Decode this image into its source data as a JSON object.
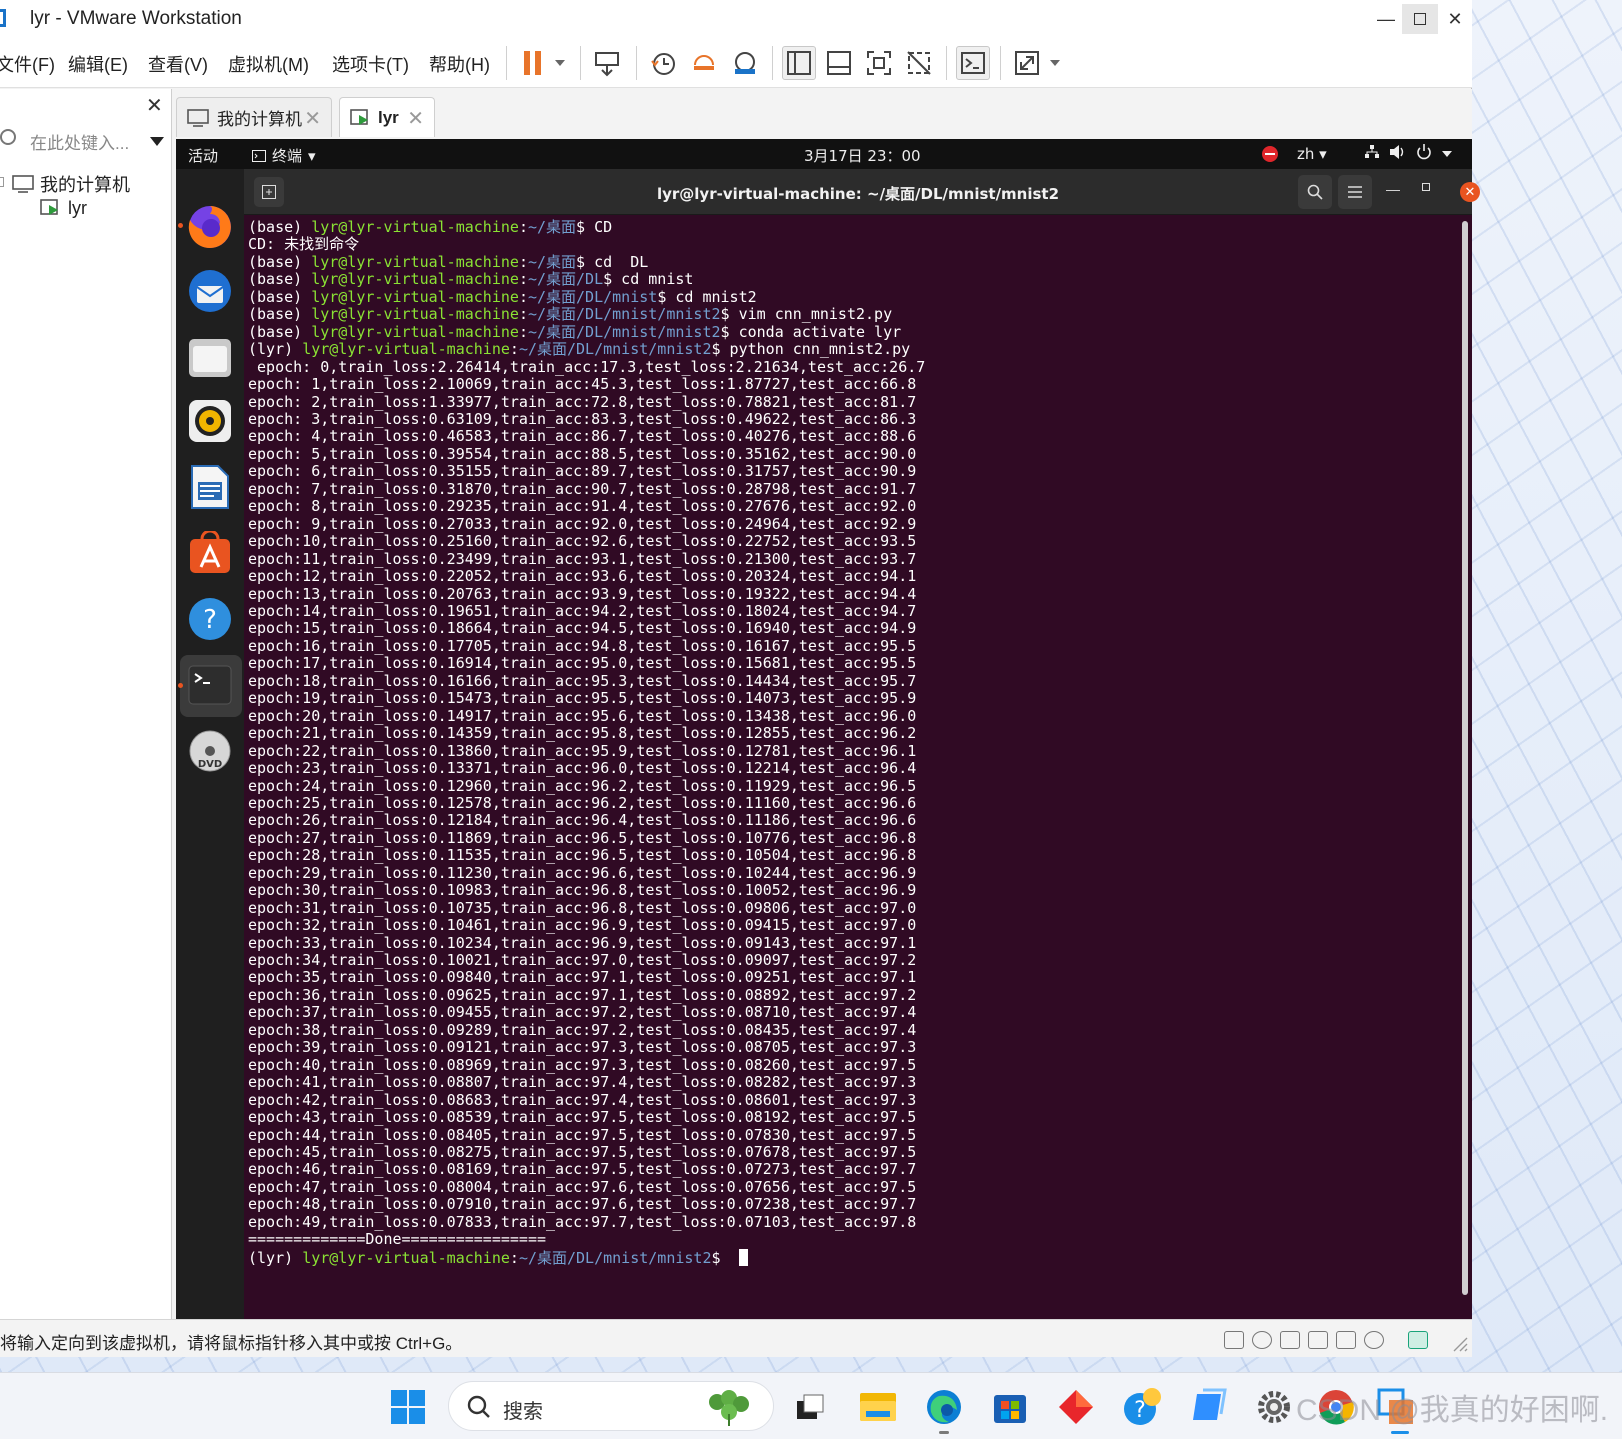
{
  "window": {
    "title": "lyr - VMware Workstation",
    "min_glyph": "—",
    "close_glyph": "✕"
  },
  "menubar": {
    "items": [
      "文件(F)",
      "编辑(E)",
      "查看(V)",
      "虚拟机(M)",
      "选项卡(T)",
      "帮助(H)"
    ]
  },
  "library": {
    "close_glyph": "✕",
    "search_placeholder": "在此处键入...",
    "tree_root": "我的计算机",
    "tree_child": "lyr"
  },
  "tabs": [
    {
      "label": "我的计算机",
      "active": false
    },
    {
      "label": "lyr",
      "active": true
    }
  ],
  "guest_topbar": {
    "activities": "活动",
    "terminal_label": "终端",
    "clock": "3月17日  23：00",
    "lang": "zh"
  },
  "terminal": {
    "title": "lyr@lyr-virtual-machine: ~/桌面/DL/mnist/mnist2",
    "close_glyph": "✕",
    "min_glyph": "—",
    "prompt_user": "lyr@lyr-virtual-machine",
    "commands": [
      {
        "env": "(base)",
        "path": "~/桌面",
        "cmd": " CD"
      },
      {
        "output": "CD: 未找到命令"
      },
      {
        "env": "(base)",
        "path": "~/桌面",
        "cmd": " cd  DL"
      },
      {
        "env": "(base)",
        "path": "~/桌面/DL",
        "cmd": " cd mnist"
      },
      {
        "env": "(base)",
        "path": "~/桌面/DL/mnist",
        "cmd": " cd mnist2"
      },
      {
        "env": "(base)",
        "path": "~/桌面/DL/mnist/mnist2",
        "cmd": " vim cnn_mnist2.py"
      },
      {
        "env": "(base)",
        "path": "~/桌面/DL/mnist/mnist2",
        "cmd": " conda activate lyr"
      },
      {
        "env": "(lyr)",
        "path": "~/桌面/DL/mnist/mnist2",
        "cmd": " python cnn_mnist2.py"
      }
    ],
    "epoch_lines": [
      " epoch: 0,train_loss:2.26414,train_acc:17.3,test_loss:2.21634,test_acc:26.7",
      "epoch: 1,train_loss:2.10069,train_acc:45.3,test_loss:1.87727,test_acc:66.8",
      "epoch: 2,train_loss:1.33977,train_acc:72.8,test_loss:0.78821,test_acc:81.7",
      "epoch: 3,train_loss:0.63109,train_acc:83.3,test_loss:0.49622,test_acc:86.3",
      "epoch: 4,train_loss:0.46583,train_acc:86.7,test_loss:0.40276,test_acc:88.6",
      "epoch: 5,train_loss:0.39554,train_acc:88.5,test_loss:0.35162,test_acc:90.0",
      "epoch: 6,train_loss:0.35155,train_acc:89.7,test_loss:0.31757,test_acc:90.9",
      "epoch: 7,train_loss:0.31870,train_acc:90.7,test_loss:0.28798,test_acc:91.7",
      "epoch: 8,train_loss:0.29235,train_acc:91.4,test_loss:0.27676,test_acc:92.0",
      "epoch: 9,train_loss:0.27033,train_acc:92.0,test_loss:0.24964,test_acc:92.9",
      "epoch:10,train_loss:0.25160,train_acc:92.6,test_loss:0.22752,test_acc:93.5",
      "epoch:11,train_loss:0.23499,train_acc:93.1,test_loss:0.21300,test_acc:93.7",
      "epoch:12,train_loss:0.22052,train_acc:93.6,test_loss:0.20324,test_acc:94.1",
      "epoch:13,train_loss:0.20763,train_acc:93.9,test_loss:0.19322,test_acc:94.4",
      "epoch:14,train_loss:0.19651,train_acc:94.2,test_loss:0.18024,test_acc:94.7",
      "epoch:15,train_loss:0.18664,train_acc:94.5,test_loss:0.16940,test_acc:94.9",
      "epoch:16,train_loss:0.17705,train_acc:94.8,test_loss:0.16167,test_acc:95.5",
      "epoch:17,train_loss:0.16914,train_acc:95.0,test_loss:0.15681,test_acc:95.5",
      "epoch:18,train_loss:0.16166,train_acc:95.3,test_loss:0.14434,test_acc:95.7",
      "epoch:19,train_loss:0.15473,train_acc:95.5,test_loss:0.14073,test_acc:95.9",
      "epoch:20,train_loss:0.14917,train_acc:95.6,test_loss:0.13438,test_acc:96.0",
      "epoch:21,train_loss:0.14359,train_acc:95.8,test_loss:0.12855,test_acc:96.2",
      "epoch:22,train_loss:0.13860,train_acc:95.9,test_loss:0.12781,test_acc:96.1",
      "epoch:23,train_loss:0.13371,train_acc:96.0,test_loss:0.12214,test_acc:96.4",
      "epoch:24,train_loss:0.12960,train_acc:96.2,test_loss:0.11929,test_acc:96.5",
      "epoch:25,train_loss:0.12578,train_acc:96.2,test_loss:0.11160,test_acc:96.6",
      "epoch:26,train_loss:0.12184,train_acc:96.4,test_loss:0.11186,test_acc:96.6",
      "epoch:27,train_loss:0.11869,train_acc:96.5,test_loss:0.10776,test_acc:96.8",
      "epoch:28,train_loss:0.11535,train_acc:96.5,test_loss:0.10504,test_acc:96.8",
      "epoch:29,train_loss:0.11230,train_acc:96.6,test_loss:0.10244,test_acc:96.9",
      "epoch:30,train_loss:0.10983,train_acc:96.8,test_loss:0.10052,test_acc:96.9",
      "epoch:31,train_loss:0.10735,train_acc:96.8,test_loss:0.09806,test_acc:97.0",
      "epoch:32,train_loss:0.10461,train_acc:96.9,test_loss:0.09415,test_acc:97.0",
      "epoch:33,train_loss:0.10234,train_acc:96.9,test_loss:0.09143,test_acc:97.1",
      "epoch:34,train_loss:0.10021,train_acc:97.0,test_loss:0.09097,test_acc:97.2",
      "epoch:35,train_loss:0.09840,train_acc:97.1,test_loss:0.09251,test_acc:97.1",
      "epoch:36,train_loss:0.09625,train_acc:97.1,test_loss:0.08892,test_acc:97.2",
      "epoch:37,train_loss:0.09455,train_acc:97.2,test_loss:0.08710,test_acc:97.4",
      "epoch:38,train_loss:0.09289,train_acc:97.2,test_loss:0.08435,test_acc:97.4",
      "epoch:39,train_loss:0.09121,train_acc:97.3,test_loss:0.08705,test_acc:97.3",
      "epoch:40,train_loss:0.08969,train_acc:97.3,test_loss:0.08260,test_acc:97.5",
      "epoch:41,train_loss:0.08807,train_acc:97.4,test_loss:0.08282,test_acc:97.3",
      "epoch:42,train_loss:0.08683,train_acc:97.4,test_loss:0.08601,test_acc:97.3",
      "epoch:43,train_loss:0.08539,train_acc:97.5,test_loss:0.08192,test_acc:97.5",
      "epoch:44,train_loss:0.08405,train_acc:97.5,test_loss:0.07830,test_acc:97.5",
      "epoch:45,train_loss:0.08275,train_acc:97.5,test_loss:0.07678,test_acc:97.5",
      "epoch:46,train_loss:0.08169,train_acc:97.5,test_loss:0.07273,test_acc:97.7",
      "epoch:47,train_loss:0.08004,train_acc:97.6,test_loss:0.07656,test_acc:97.5",
      "epoch:48,train_loss:0.07910,train_acc:97.6,test_loss:0.07238,test_acc:97.7",
      "epoch:49,train_loss:0.07833,train_acc:97.7,test_loss:0.07103,test_acc:97.8"
    ],
    "done_line": "=============Done================",
    "final_prompt": {
      "env": "(lyr)",
      "path": "~/桌面/DL/mnist/mnist2"
    }
  },
  "statusbar": {
    "text": "将输入定向到该虚拟机，请将鼠标指针移入其中或按 Ctrl+G。"
  },
  "taskbar": {
    "search_label": "搜索",
    "watermark": "CSDN @我真的好困啊."
  },
  "colors": {
    "terminal_bg": "#300a24",
    "prompt_user": "#8ae234",
    "prompt_path": "#729fcf",
    "ubuntu_orange": "#e95420",
    "vmware_pause": "#e8742a"
  }
}
